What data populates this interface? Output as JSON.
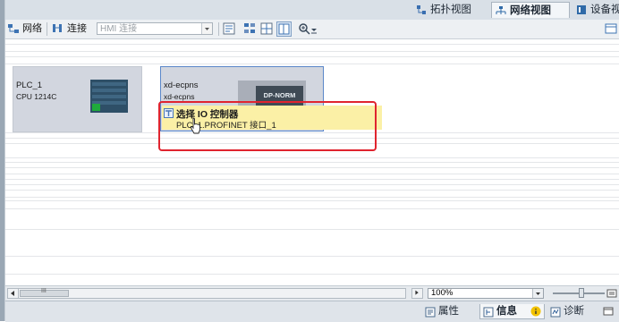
{
  "top_tabs": [
    {
      "label": "拓扑视图",
      "icon": "topology-view-icon"
    },
    {
      "label": "网络视图",
      "icon": "network-view-icon"
    },
    {
      "label": "设备视",
      "icon": "device-view-icon"
    }
  ],
  "toolbar": {
    "network_label": "网络",
    "connect_label": "连接",
    "hmi_placeholder": "HMI 连接"
  },
  "devices": [
    {
      "name": "PLC_1",
      "subtitle": "CPU 1214C"
    },
    {
      "name": "xd-ecpns",
      "subtitle": "xd-ecpns",
      "badge": "DP-NORM"
    }
  ],
  "tooltip": {
    "title": "选择 IO 控制器",
    "item": "PLC_1.PROFINET 接口_1"
  },
  "scroll": {
    "grip": "III"
  },
  "zoom": {
    "value": "100%"
  },
  "bottom_tabs": [
    {
      "label": "属性",
      "icon": "properties-icon"
    },
    {
      "label": "信息",
      "icon": "info-icon"
    },
    {
      "label": "诊断",
      "icon": "diagnostics-icon"
    }
  ],
  "colors": {
    "highlight_red": "#e0242f",
    "tooltip_bg": "#fbf0a6",
    "device_fill": "#d2d6df",
    "selected_outline": "#5b87c9"
  }
}
